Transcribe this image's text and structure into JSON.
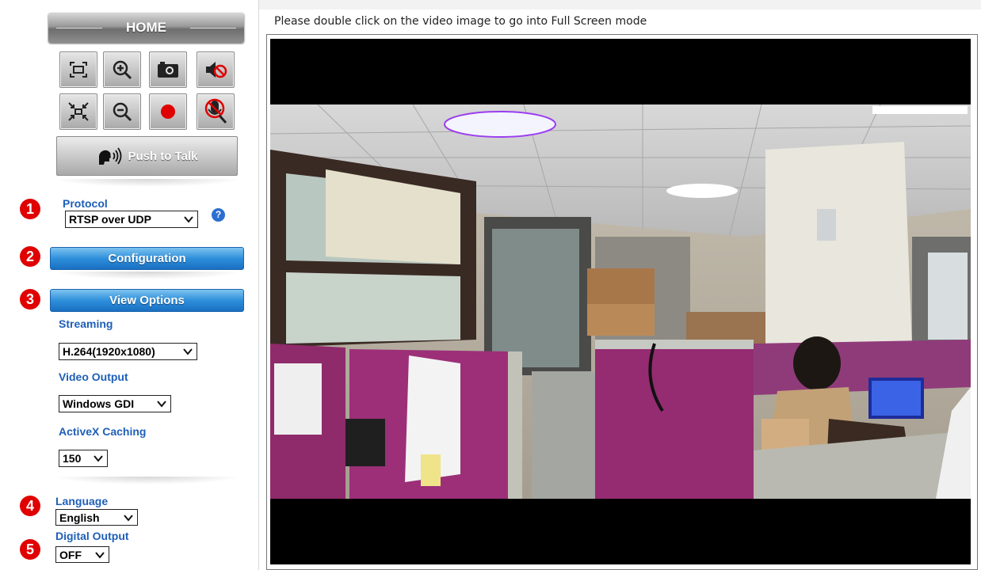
{
  "sidebar": {
    "home_label": "HOME",
    "toolbar_icons": [
      "fullscreen-icon",
      "zoom-in-icon",
      "snapshot-icon",
      "mute-speaker-icon",
      "fit-screen-icon",
      "zoom-out-icon",
      "record-icon",
      "mute-mic-icon"
    ],
    "push_to_talk_label": "Push to Talk",
    "steps": [
      "1",
      "2",
      "3",
      "4",
      "5"
    ],
    "protocol": {
      "label": "Protocol",
      "value": "RTSP over UDP",
      "help": "?"
    },
    "configuration_label": "Configuration",
    "view_options_label": "View Options",
    "streaming": {
      "label": "Streaming",
      "value": "H.264(1920x1080)"
    },
    "video_output": {
      "label": "Video Output",
      "value": "Windows GDI"
    },
    "activex_caching": {
      "label": "ActiveX Caching",
      "value": "150"
    },
    "language": {
      "label": "Language",
      "value": "English"
    },
    "digital_output": {
      "label": "Digital Output",
      "value": "OFF"
    }
  },
  "main": {
    "hint": "Please double click on the video image to go into Full Screen mode"
  },
  "colors": {
    "accent_blue": "#1e5fb8",
    "step_red": "#e00000",
    "button_blue": "#2e8fdb"
  }
}
